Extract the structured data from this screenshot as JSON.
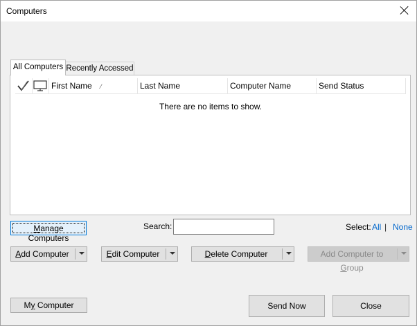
{
  "window": {
    "title": "Computers"
  },
  "tabs": [
    {
      "label": "All Computers",
      "active": true
    },
    {
      "label": "Recently Accessed",
      "active": false
    }
  ],
  "list": {
    "columns": [
      "",
      "",
      "First Name",
      "Last Name",
      "Computer Name",
      "Send Status"
    ],
    "sort_column": "First Name",
    "empty_message": "There are no items to show."
  },
  "manage_button": {
    "pre": "",
    "ul": "M",
    "post": "anage Computers"
  },
  "search": {
    "label": "Search:",
    "value": "",
    "placeholder": ""
  },
  "select": {
    "label": "Select:",
    "all": "All",
    "separator": "|",
    "none": "None"
  },
  "actions": {
    "add": {
      "pre": "",
      "ul": "A",
      "post": "dd Computer"
    },
    "edit": {
      "pre": "",
      "ul": "E",
      "post": "dit Computer"
    },
    "delete": {
      "pre": "",
      "ul": "D",
      "post": "elete Computer"
    },
    "add_group": {
      "pre": "Add Computer to ",
      "ul": "G",
      "post": "roup",
      "disabled": true
    }
  },
  "footer": {
    "my_computer": {
      "pre": "M",
      "ul": "y",
      "post": " Computer"
    },
    "send_now": "Send Now",
    "close": "Close"
  },
  "colors": {
    "link": "#0066cc",
    "focus_border": "#0078d7",
    "button_face": "#e1e1e1",
    "window_bg": "#f0f0f0"
  },
  "icons": {
    "checkmark_header": "checkmark-icon",
    "monitor_header": "monitor-icon",
    "close": "close-icon",
    "dropdown": "chevron-down-icon"
  }
}
